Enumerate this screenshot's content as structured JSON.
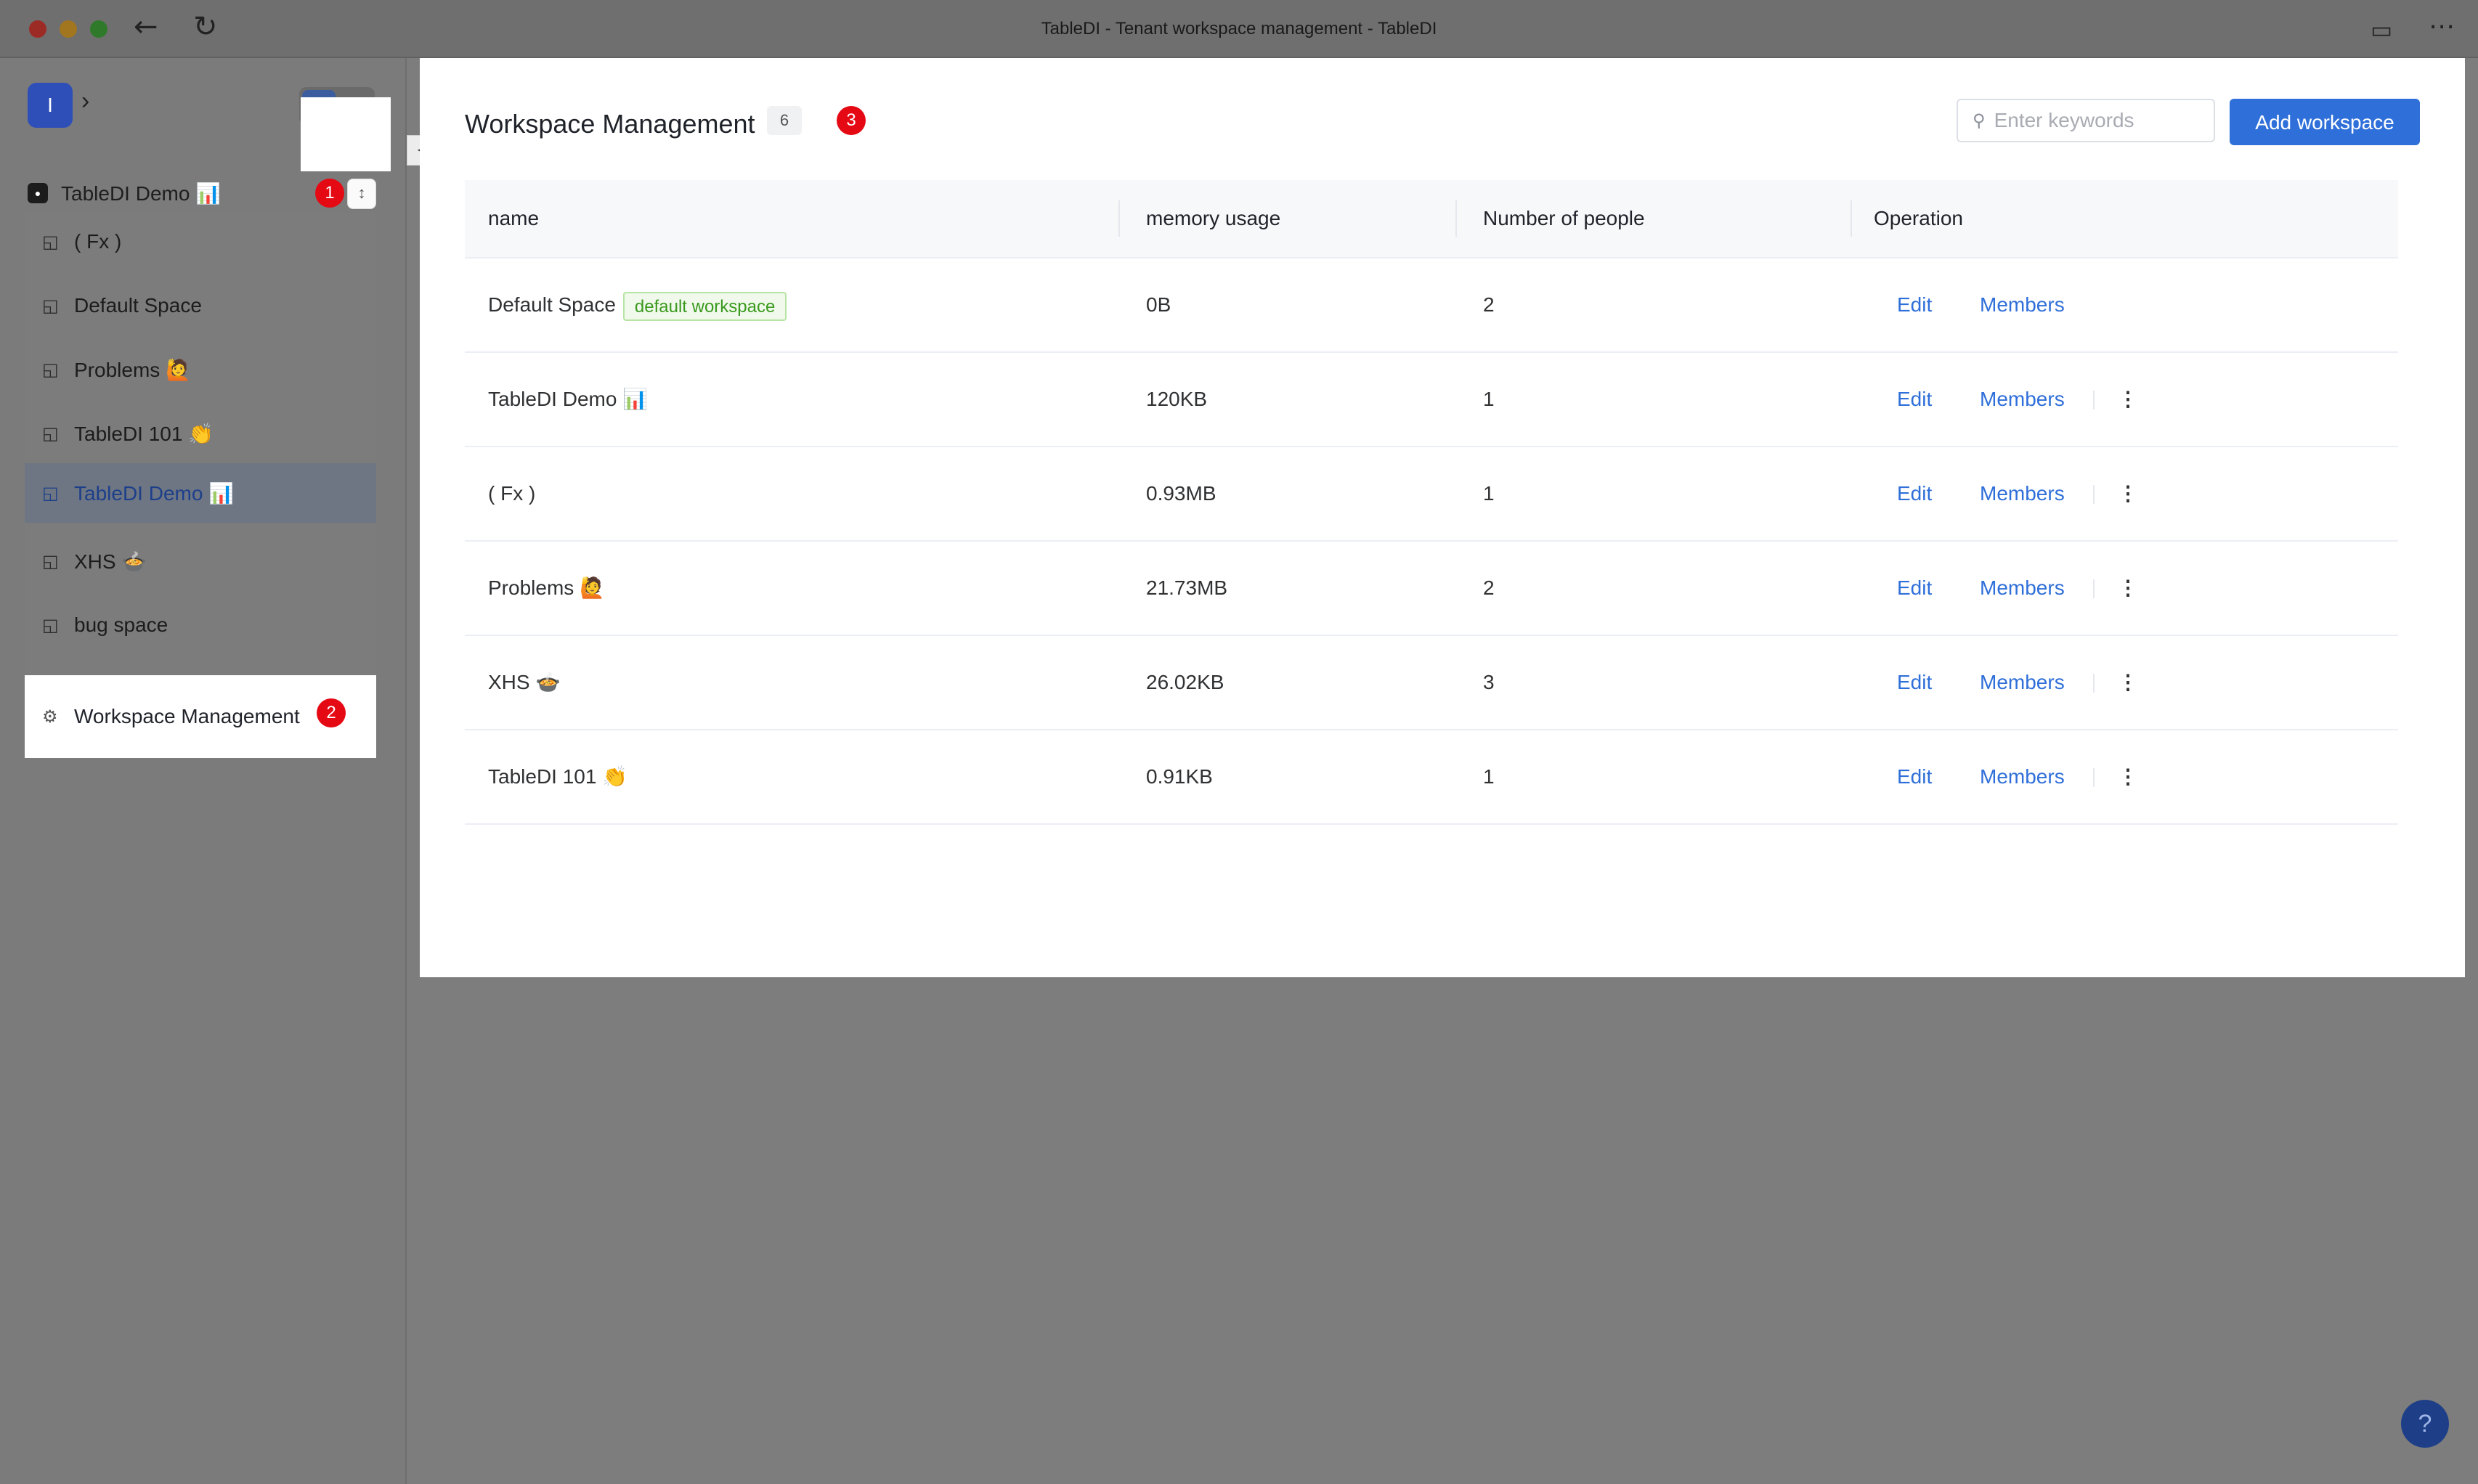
{
  "window": {
    "title": "TableDI - Tenant workspace management - TableDI"
  },
  "sidebar": {
    "logo_letter": "I",
    "current_workspace": "TableDI Demo 📊",
    "switcher_step": "1",
    "menu_items": [
      {
        "label": "( Fx )"
      },
      {
        "label": "Default Space"
      },
      {
        "label": "Problems 🙋"
      },
      {
        "label": "TableDI 101 👏"
      },
      {
        "label": "TableDI Demo 📊",
        "active": true
      },
      {
        "label": "XHS 🍲"
      },
      {
        "label": "bug space"
      }
    ],
    "manage_label": "Workspace Management",
    "manage_step": "2"
  },
  "panel": {
    "title": "Workspace Management",
    "count": "6",
    "title_step": "3",
    "search_placeholder": "Enter keywords",
    "add_button": "Add workspace",
    "columns": [
      "name",
      "memory usage",
      "Number of people",
      "Operation"
    ],
    "rows": [
      {
        "name": "Default Space",
        "tag": "default workspace",
        "memory": "0B",
        "people": "2",
        "edit": "Edit",
        "members": "Members"
      },
      {
        "name": "TableDI Demo 📊",
        "memory": "120KB",
        "people": "1",
        "edit": "Edit",
        "members": "Members"
      },
      {
        "name": "( Fx )",
        "memory": "0.93MB",
        "people": "1",
        "edit": "Edit",
        "members": "Members"
      },
      {
        "name": "Problems 🙋",
        "memory": "21.73MB",
        "people": "2",
        "edit": "Edit",
        "members": "Members"
      },
      {
        "name": "XHS 🍲",
        "memory": "26.02KB",
        "people": "3",
        "edit": "Edit",
        "members": "Members"
      },
      {
        "name": "TableDI 101 👏",
        "memory": "0.91KB",
        "people": "1",
        "edit": "Edit",
        "members": "Members"
      }
    ]
  },
  "help": {
    "label": "?"
  },
  "colors": {
    "accent": "#2f6fd9",
    "step_badge": "#e50914",
    "default_tag": "#3a9a1e"
  }
}
